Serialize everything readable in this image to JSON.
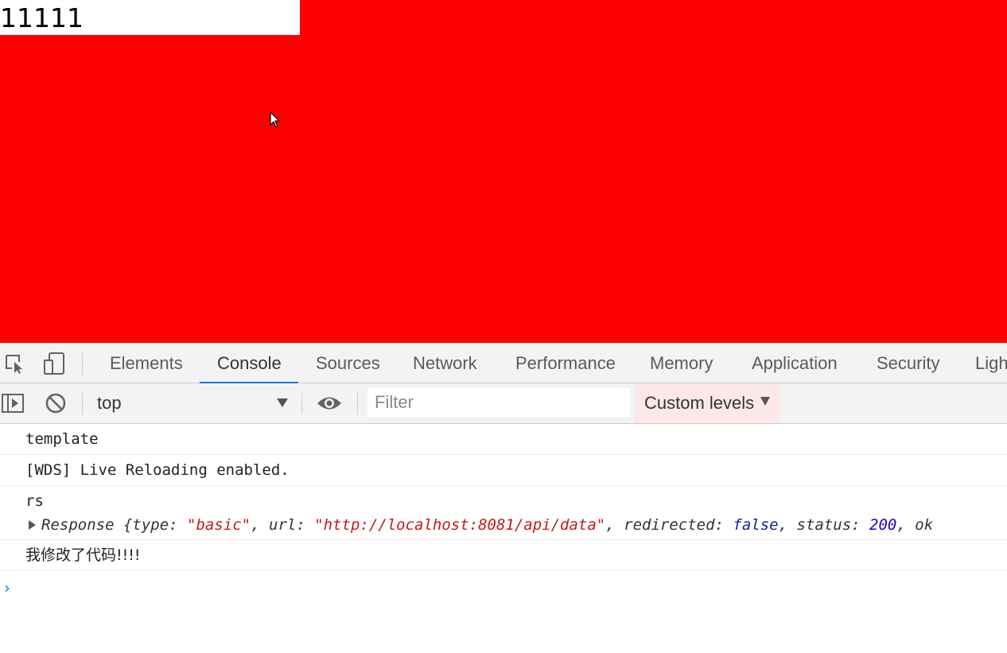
{
  "page": {
    "input_value": "11111",
    "background_color": "#ff0000"
  },
  "devtools": {
    "tabs": [
      {
        "label": "Elements",
        "active": false
      },
      {
        "label": "Console",
        "active": true
      },
      {
        "label": "Sources",
        "active": false
      },
      {
        "label": "Network",
        "active": false
      },
      {
        "label": "Performance",
        "active": false
      },
      {
        "label": "Memory",
        "active": false
      },
      {
        "label": "Application",
        "active": false
      },
      {
        "label": "Security",
        "active": false
      },
      {
        "label": "Ligh",
        "active": false
      }
    ],
    "accent_color": "#1a73e8",
    "toolbar": {
      "context": "top",
      "filter_placeholder": "Filter",
      "custom_levels": "Custom levels"
    },
    "messages": {
      "m1": "template",
      "m2": "[WDS] Live Reloading enabled.",
      "m3_label": "rs",
      "m3_response": {
        "prefix": "Response {",
        "k_type": "type: ",
        "v_type": "\"basic\"",
        "sep1": ", ",
        "k_url": "url: ",
        "v_url": "\"http://localhost:8081/api/data\"",
        "sep2": ", ",
        "k_redirected": "redirected: ",
        "v_redirected": "false",
        "sep3": ", ",
        "k_status": "status: ",
        "v_status": "200",
        "sep4": ", ",
        "k_ok": "ok"
      },
      "m4": "我修改了代码!!!!"
    },
    "prompt_symbol": "›"
  }
}
